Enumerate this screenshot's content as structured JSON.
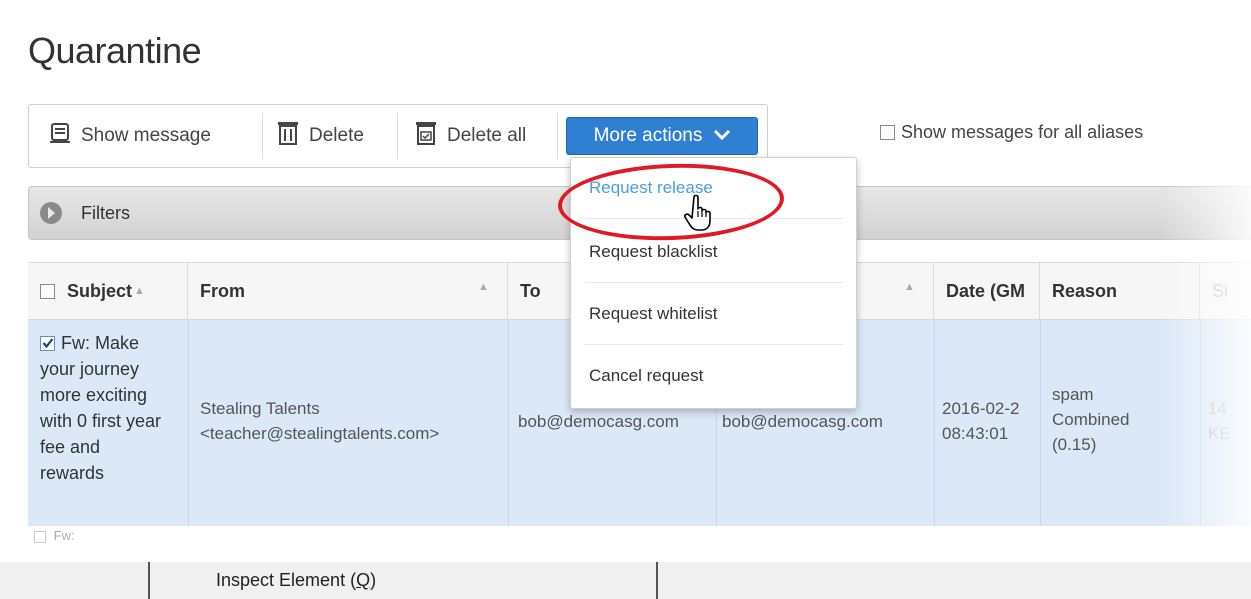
{
  "page": {
    "title": "Quarantine"
  },
  "toolbar": {
    "show_message": "Show message",
    "delete": "Delete",
    "delete_all": "Delete all",
    "more_actions": "More actions",
    "show_all_aliases": "Show messages for all aliases",
    "show_all_aliases_checked": false
  },
  "filters": {
    "label": "Filters"
  },
  "table": {
    "headers": {
      "subject": "Subject",
      "from": "From",
      "to": "To",
      "date": "Date (GM",
      "reason": "Reason",
      "size": "Si"
    },
    "rows": [
      {
        "checked": true,
        "subject_lines": [
          "Fw: Make",
          "your journey",
          "more exciting",
          "with 0 first year",
          "fee and",
          "rewards"
        ],
        "from_name": "Stealing Talents",
        "from_email": "<teacher@stealingtalents.com>",
        "to": "bob@democasg.com",
        "recipient": "bob@democasg.com",
        "date_line1": "2016-02-2",
        "date_line2": "08:43:01",
        "reason_lines": [
          "spam",
          "Combined",
          "(0.15)"
        ],
        "size_line1": "14",
        "size_line2": "KE"
      }
    ],
    "next_row_partial": "Fw:"
  },
  "dropdown": {
    "items": [
      {
        "label": "Request release",
        "highlighted": true
      },
      {
        "label": "Request blacklist",
        "highlighted": false
      },
      {
        "label": "Request whitelist",
        "highlighted": false
      },
      {
        "label": "Cancel request",
        "highlighted": false
      }
    ]
  },
  "context_menu": {
    "item_prefix": "Inspect Element (",
    "item_key": "Q",
    "item_suffix": ")"
  },
  "colors": {
    "accent": "#2f7fd3",
    "selected_row": "#dbe8f7",
    "highlight_ring": "#e01a22",
    "link_hover": "#4a9fe0"
  }
}
